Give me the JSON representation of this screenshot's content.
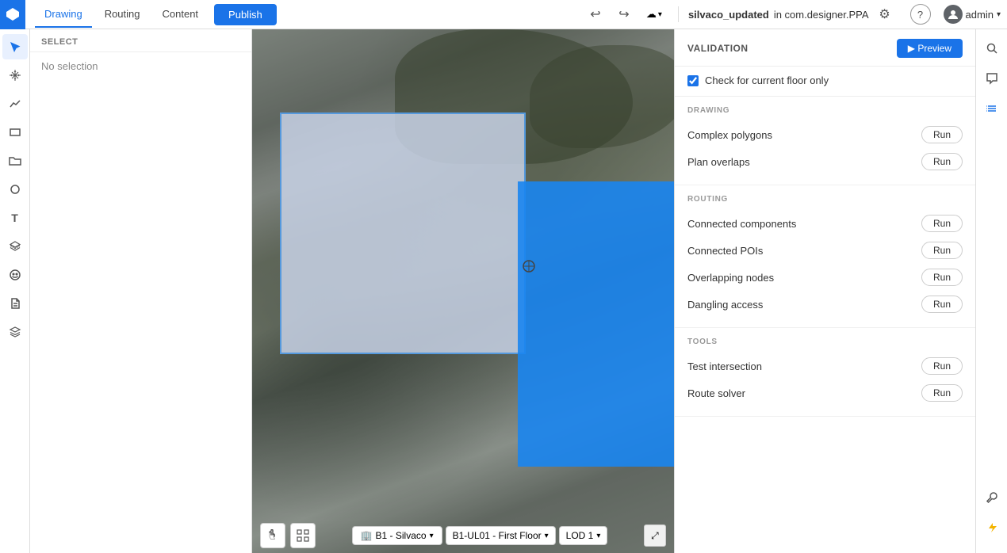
{
  "topbar": {
    "logo_label": "Logo",
    "tabs": [
      {
        "id": "drawing",
        "label": "Drawing",
        "active": true
      },
      {
        "id": "routing",
        "label": "Routing",
        "active": false
      },
      {
        "id": "content",
        "label": "Content",
        "active": false
      }
    ],
    "publish_label": "Publish",
    "undo_icon": "↩",
    "redo_icon": "↪",
    "cloud_label": "☁",
    "project_name": "silvaco_updated",
    "project_path": "in com.designer.PPA",
    "gear_icon": "⚙",
    "help_icon": "?",
    "user_label": "admin",
    "chevron_down": "▾"
  },
  "left_sidebar": {
    "icons": [
      {
        "id": "select",
        "glyph": "↖",
        "active": true
      },
      {
        "id": "pan",
        "glyph": "↗",
        "active": false
      },
      {
        "id": "analytics",
        "glyph": "∿",
        "active": false
      },
      {
        "id": "rectangle",
        "glyph": "▭",
        "active": false
      },
      {
        "id": "folder",
        "glyph": "⏍",
        "active": false
      },
      {
        "id": "circle",
        "glyph": "○",
        "active": false
      },
      {
        "id": "text",
        "glyph": "T",
        "active": false
      },
      {
        "id": "layers3d",
        "glyph": "◈",
        "active": false
      },
      {
        "id": "face",
        "glyph": "☺",
        "active": false
      },
      {
        "id": "document",
        "glyph": "📄",
        "active": false
      },
      {
        "id": "stack",
        "glyph": "⊞",
        "active": false
      }
    ]
  },
  "panel": {
    "title": "SELECT",
    "no_selection": "No selection"
  },
  "canvas": {
    "bottom": {
      "hand_tool": "✋",
      "snap_tool": "⊞",
      "floor_icon": "🏢",
      "floor_label": "B1 - Silvaco",
      "floor_dropdown_icon": "▾",
      "level_label": "B1-UL01 - First Floor",
      "level_dropdown_icon": "▾",
      "lod_label": "LOD 1",
      "lod_dropdown_icon": "▾",
      "fullscreen_icon": "⤢"
    }
  },
  "right_panel": {
    "title": "VALIDATION",
    "preview_label": "▶  Preview",
    "check_label": "Check for current floor only",
    "sections": {
      "drawing": {
        "label": "DRAWING",
        "items": [
          {
            "label": "Complex polygons",
            "btn": "Run"
          },
          {
            "label": "Plan overlaps",
            "btn": "Run"
          }
        ]
      },
      "routing": {
        "label": "ROUTING",
        "items": [
          {
            "label": "Connected components",
            "btn": "Run"
          },
          {
            "label": "Connected POIs",
            "btn": "Run"
          },
          {
            "label": "Overlapping nodes",
            "btn": "Run"
          },
          {
            "label": "Dangling access",
            "btn": "Run"
          }
        ]
      },
      "tools": {
        "label": "TOOLS",
        "items": [
          {
            "label": "Test intersection",
            "btn": "Run"
          },
          {
            "label": "Route solver",
            "btn": "Run"
          }
        ]
      }
    }
  },
  "far_right": {
    "icons": [
      {
        "id": "search",
        "glyph": "🔍",
        "active": false
      },
      {
        "id": "chat",
        "glyph": "💬",
        "active": false
      },
      {
        "id": "list",
        "glyph": "≡",
        "active": true
      }
    ],
    "bottom_icons": [
      {
        "id": "tools",
        "glyph": "🔧",
        "active": false
      },
      {
        "id": "lightning",
        "glyph": "⚡",
        "active": false,
        "color": "#f4b400"
      }
    ]
  }
}
